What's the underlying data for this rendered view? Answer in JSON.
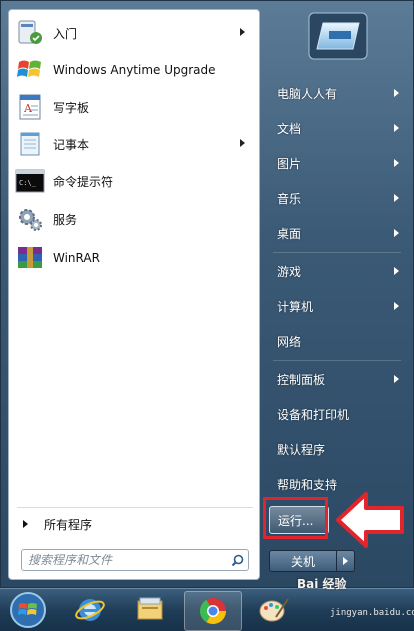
{
  "left_pane": {
    "programs": [
      {
        "label": "入门",
        "icon": "getting-started-icon",
        "has_submenu": true
      },
      {
        "label": "Windows Anytime Upgrade",
        "icon": "windows-flag-icon",
        "has_submenu": false
      },
      {
        "label": "写字板",
        "icon": "wordpad-icon",
        "has_submenu": false
      },
      {
        "label": "记事本",
        "icon": "notepad-icon",
        "has_submenu": true
      },
      {
        "label": "命令提示符",
        "icon": "command-prompt-icon",
        "has_submenu": false
      },
      {
        "label": "服务",
        "icon": "services-gear-icon",
        "has_submenu": false
      },
      {
        "label": "WinRAR",
        "icon": "winrar-icon",
        "has_submenu": false
      }
    ],
    "all_programs_label": "所有程序",
    "search_placeholder": "搜索程序和文件"
  },
  "right_pane": {
    "places": [
      {
        "label": "电脑人人有",
        "has_submenu": true
      },
      {
        "label": "文档",
        "has_submenu": true
      },
      {
        "label": "图片",
        "has_submenu": true
      },
      {
        "label": "音乐",
        "has_submenu": true
      },
      {
        "label": "桌面",
        "has_submenu": true
      },
      {
        "label": "游戏",
        "has_submenu": true
      },
      {
        "label": "计算机",
        "has_submenu": true
      },
      {
        "label": "网络",
        "has_submenu": false
      },
      {
        "label": "控制面板",
        "has_submenu": true
      },
      {
        "label": "设备和打印机",
        "has_submenu": false
      },
      {
        "label": "默认程序",
        "has_submenu": false
      },
      {
        "label": "帮助和支持",
        "has_submenu": false
      }
    ],
    "run_label": "运行...",
    "shutdown_label": "关机"
  },
  "annotation": {
    "highlight_color": "#e0262c"
  },
  "taskbar": {
    "buttons": [
      "start-orb-icon",
      "internet-explorer-icon",
      "file-explorer-icon",
      "chrome-icon",
      "paint-icon"
    ]
  },
  "watermark": {
    "text": "Bai 经验",
    "sub": "jingyan.baidu.com"
  }
}
